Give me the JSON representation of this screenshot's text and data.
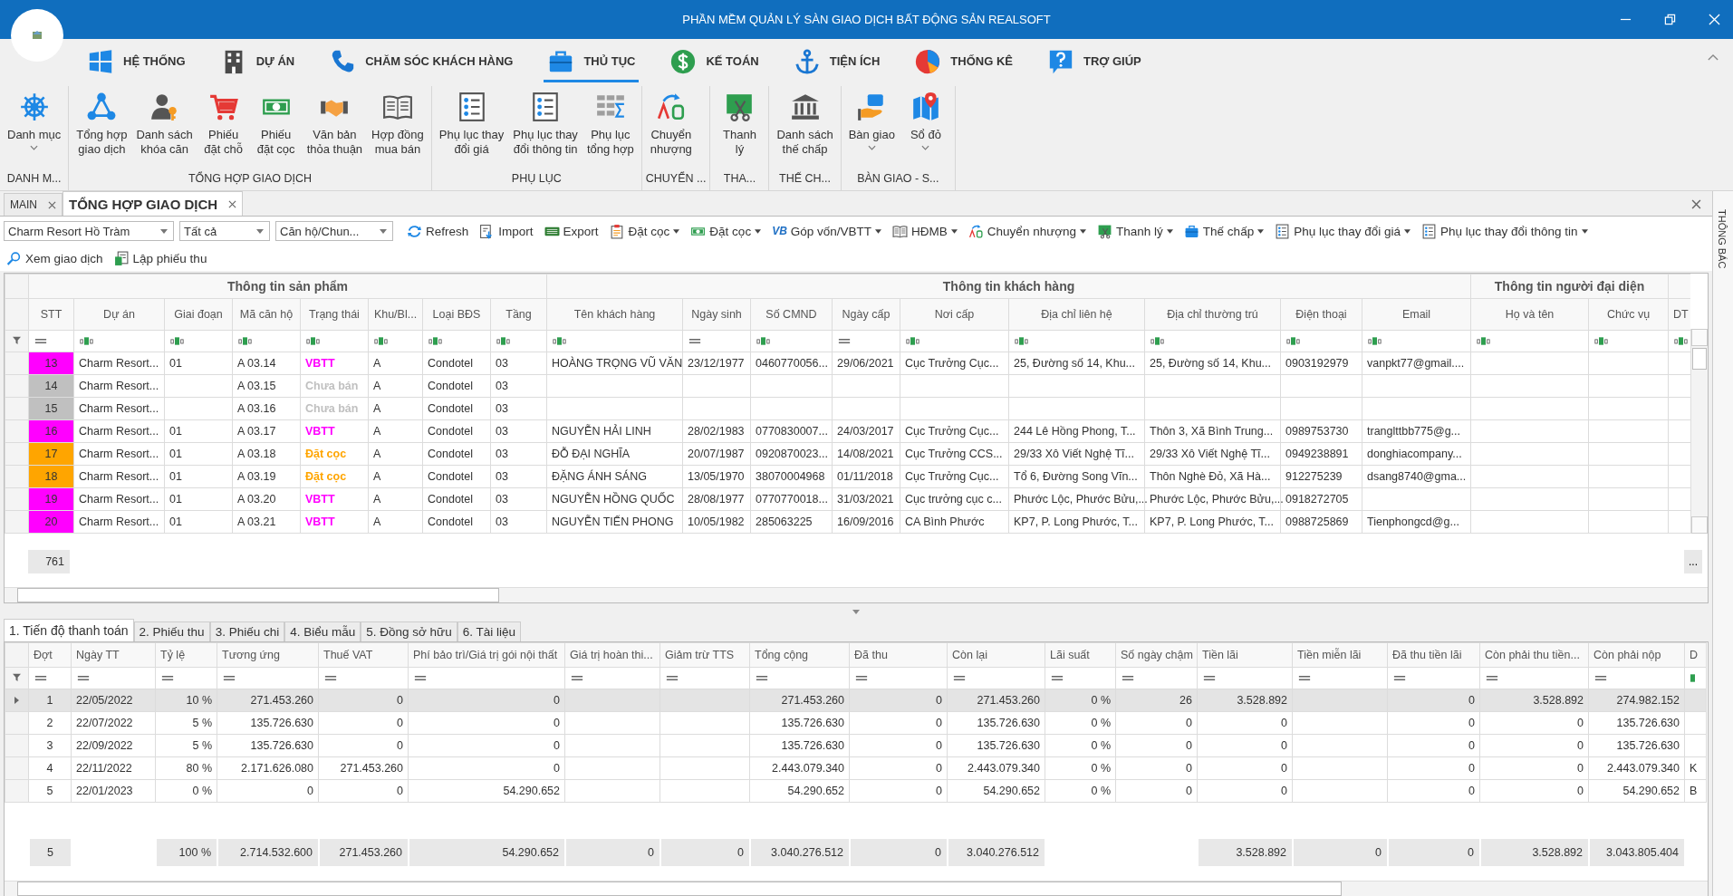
{
  "window": {
    "title": "PHẦN MỀM QUẢN LÝ SÀN GIAO DỊCH BẤT ĐỘNG SẢN REALSOFT"
  },
  "ribbon_tabs": [
    {
      "label": "HỆ THỐNG",
      "selected": false
    },
    {
      "label": "DỰ ÁN",
      "selected": false
    },
    {
      "label": "CHĂM SÓC KHÁCH HÀNG",
      "selected": false
    },
    {
      "label": "THỦ TỤC",
      "selected": true
    },
    {
      "label": "KẾ TOÁN",
      "selected": false
    },
    {
      "label": "TIỆN ÍCH",
      "selected": false
    },
    {
      "label": "THỐNG KÊ",
      "selected": false
    },
    {
      "label": "TRỢ GIÚP",
      "selected": false
    }
  ],
  "ribbon_groups": [
    {
      "label": "DANH M...",
      "buttons": [
        {
          "label": "Danh mục",
          "dropdown": true
        }
      ]
    },
    {
      "label": "TỔNG HỢP GIAO DỊCH",
      "buttons": [
        {
          "label": "Tổng hợp\ngiao dịch",
          "dropdown": false
        },
        {
          "label": "Danh sách\nkhóa căn",
          "dropdown": false
        },
        {
          "label": "Phiếu\nđặt chỗ",
          "dropdown": false
        },
        {
          "label": "Phiếu\nđặt cọc",
          "dropdown": false
        },
        {
          "label": "Văn bản\nthỏa thuận",
          "dropdown": false
        },
        {
          "label": "Hợp đồng\nmua bán",
          "dropdown": false
        }
      ]
    },
    {
      "label": "PHỤ LỤC",
      "buttons": [
        {
          "label": "Phụ lục thay\nđổi giá",
          "dropdown": false
        },
        {
          "label": "Phụ lục thay\nđổi thông tin",
          "dropdown": false
        },
        {
          "label": "Phụ lục\ntổng hợp",
          "dropdown": false
        }
      ]
    },
    {
      "label": "CHUYỂN ...",
      "buttons": [
        {
          "label": "Chuyển\nnhượng",
          "dropdown": false
        }
      ]
    },
    {
      "label": "THA...",
      "buttons": [
        {
          "label": "Thanh\nlý",
          "dropdown": false
        }
      ]
    },
    {
      "label": "THẾ CH...",
      "buttons": [
        {
          "label": "Danh sách\nthế chấp",
          "dropdown": false
        }
      ]
    },
    {
      "label": "BÀN GIAO - S...",
      "buttons": [
        {
          "label": "Bàn giao",
          "dropdown": true
        },
        {
          "label": "Sổ đỏ",
          "dropdown": true
        }
      ]
    }
  ],
  "doc_tabs": [
    {
      "label": "MAIN",
      "selected": false
    },
    {
      "label": "TỔNG HỢP GIAO DỊCH",
      "selected": true
    }
  ],
  "side_panel": {
    "title": "THÔNG BÁC"
  },
  "toolbar": {
    "combos": [
      "Charm Resort Hồ Tràm",
      "Tất cả",
      "Căn hộ/Chun..."
    ],
    "buttons": [
      {
        "label": "Refresh",
        "dropdown": false
      },
      {
        "label": "Import",
        "dropdown": false
      },
      {
        "label": "Export",
        "dropdown": false
      },
      {
        "label": "Đặt cọc",
        "dropdown": true
      },
      {
        "label": "Đặt cọc",
        "dropdown": true
      },
      {
        "label": "Góp vốn/VBTT",
        "dropdown": true,
        "badge": "VB"
      },
      {
        "label": "HĐMB",
        "dropdown": true
      },
      {
        "label": "Chuyển nhượng",
        "dropdown": true
      },
      {
        "label": "Thanh lý",
        "dropdown": true
      },
      {
        "label": "Thế chấp",
        "dropdown": true
      },
      {
        "label": "Phụ lục thay đổi giá",
        "dropdown": true
      },
      {
        "label": "Phụ lục thay đổi thông tin",
        "dropdown": true
      }
    ],
    "buttons_2": [
      {
        "label": "Xem giao dịch"
      },
      {
        "label": "Lập phiếu thu"
      }
    ]
  },
  "upper": {
    "bands": [
      {
        "label": "Thông tin sản phẩm",
        "columns": [
          {
            "label": "STT",
            "text_filter": false,
            "kind": "stt"
          },
          {
            "label": "Dự án",
            "text_filter": true,
            "kind": "text"
          },
          {
            "label": "Giai đoạn",
            "text_filter": true,
            "kind": "text"
          },
          {
            "label": "Mã căn hộ",
            "text_filter": true,
            "kind": "text"
          },
          {
            "label": "Trạng thái",
            "text_filter": true,
            "kind": "status"
          },
          {
            "label": "Khu/Bl...",
            "text_filter": true,
            "kind": "text"
          },
          {
            "label": "Loại BĐS",
            "text_filter": true,
            "kind": "text"
          },
          {
            "label": "Tầng",
            "text_filter": true,
            "kind": "text"
          }
        ]
      },
      {
        "label": "Thông tin khách hàng",
        "columns": [
          {
            "label": "Tên khách hàng",
            "text_filter": true,
            "kind": "text"
          },
          {
            "label": "Ngày sinh",
            "text_filter": false,
            "kind": "text"
          },
          {
            "label": "Số CMND",
            "text_filter": true,
            "kind": "text"
          },
          {
            "label": "Ngày cấp",
            "text_filter": false,
            "kind": "text"
          },
          {
            "label": "Nơi cấp",
            "text_filter": true,
            "kind": "text"
          },
          {
            "label": "Địa chỉ liên hệ",
            "text_filter": true,
            "kind": "text"
          },
          {
            "label": "Địa chỉ thường trú",
            "text_filter": true,
            "kind": "text"
          },
          {
            "label": "Điện thoại",
            "text_filter": true,
            "kind": "text"
          },
          {
            "label": "Email",
            "text_filter": true,
            "kind": "text"
          }
        ]
      },
      {
        "label": "Thông tin người đại diện",
        "columns": [
          {
            "label": "Họ và tên",
            "text_filter": true,
            "kind": "text"
          },
          {
            "label": "Chức vụ",
            "text_filter": true,
            "kind": "text"
          }
        ]
      },
      {
        "columns": [
          {
            "label": "DT",
            "text_filter": true,
            "kind": "text"
          }
        ]
      }
    ],
    "rows": [
      {
        "color": "#ff00ff",
        "cells": [
          "13",
          "Charm Resort...",
          "01",
          "A 03.14",
          "VBTT",
          "A",
          "Condotel",
          "03",
          "HOÀNG TRỌNG VŨ VĂN",
          "23/12/1977",
          "0460770056...",
          "29/06/2021",
          "Cục Trưởng Cục...",
          "25, Đường số 14, Khu...",
          "25, Đường số 14, Khu...",
          "0903192979",
          "vanpkt77@gmail....",
          null,
          null,
          null
        ]
      },
      {
        "color": "#c0c0c0",
        "cells": [
          "14",
          "Charm Resort...",
          null,
          "A 03.15",
          "Chưa bán",
          "A",
          "Condotel",
          "03",
          null,
          null,
          null,
          null,
          null,
          null,
          null,
          null,
          null,
          null,
          null,
          null
        ]
      },
      {
        "color": "#c0c0c0",
        "cells": [
          "15",
          "Charm Resort...",
          null,
          "A 03.16",
          "Chưa bán",
          "A",
          "Condotel",
          "03",
          null,
          null,
          null,
          null,
          null,
          null,
          null,
          null,
          null,
          null,
          null,
          null
        ]
      },
      {
        "color": "#ff00ff",
        "cells": [
          "16",
          "Charm Resort...",
          "01",
          "A 03.17",
          "VBTT",
          "A",
          "Condotel",
          "03",
          "NGUYỄN HẢI LINH",
          "28/02/1983",
          "0770830007...",
          "24/03/2017",
          "Cục Trưởng Cục...",
          "244 Lê Hồng Phong, T...",
          "Thôn 3, Xã Bình Trung...",
          "0989753730",
          "tranglttbb775@g...",
          null,
          null,
          null
        ]
      },
      {
        "color": "#ffa500",
        "cells": [
          "17",
          "Charm Resort...",
          "01",
          "A 03.18",
          "Đặt cọc",
          "A",
          "Condotel",
          "03",
          "ĐỖ ĐẠI NGHĨA",
          "20/07/1987",
          "0920870023...",
          "14/08/2021",
          "Cục Trưởng CCS...",
          "29/33 Xô Viết Nghệ Tĩ...",
          "29/33 Xô Viết Nghệ Tĩ...",
          "0949238891",
          "donghiacompany...",
          null,
          null,
          null
        ]
      },
      {
        "color": "#ffa500",
        "cells": [
          "18",
          "Charm Resort...",
          "01",
          "A 03.19",
          "Đặt cọc",
          "A",
          "Condotel",
          "03",
          "ĐẶNG ÁNH SÁNG",
          "13/05/1970",
          "38070004968",
          "01/11/2018",
          "Cục Trưởng Cục...",
          "Tổ 6, Đường Song Vĩn...",
          "Thôn Nghè Đỏ, Xã Hà...",
          "912275239",
          "dsang8740@gma...",
          null,
          null,
          null
        ]
      },
      {
        "color": "#ff00ff",
        "cells": [
          "19",
          "Charm Resort...",
          "01",
          "A 03.20",
          "VBTT",
          "A",
          "Condotel",
          "03",
          "NGUYỄN HỒNG QUỐC",
          "28/08/1977",
          "0770770018...",
          "31/03/2021",
          "Cục trưởng cục c...",
          "Phước Lộc, Phước Bửu,...",
          "Phước Lộc, Phước Bửu,...",
          "0918272705",
          null,
          null,
          null,
          null
        ]
      },
      {
        "color": "#ff00ff",
        "cells": [
          "20",
          "Charm Resort...",
          "01",
          "A 03.21",
          "VBTT",
          "A",
          "Condotel",
          "03",
          "NGUYỄN TIẾN PHONG",
          "10/05/1982",
          "285063225",
          "16/09/2016",
          "CA Bình Phước",
          "KP7, P. Long Phước, T...",
          "KP7, P. Long Phước, T...",
          "0988725869",
          "Tienphongcd@g...",
          null,
          null,
          null
        ]
      }
    ],
    "total": "761",
    "more_button": "..."
  },
  "lower_tabs": [
    {
      "label": "1. Tiến độ thanh toán",
      "selected": true
    },
    {
      "label": "2. Phiếu thu",
      "selected": false
    },
    {
      "label": "3. Phiếu chi",
      "selected": false
    },
    {
      "label": "4. Biểu mẫu",
      "selected": false
    },
    {
      "label": "5. Đồng sở hữu",
      "selected": false
    },
    {
      "label": "6. Tài liệu",
      "selected": false
    }
  ],
  "lower": {
    "columns": [
      {
        "label": "Đợt",
        "kind": "center",
        "text_filter": false
      },
      {
        "label": "Ngày TT",
        "kind": "text",
        "text_filter": false
      },
      {
        "label": "Tỷ lệ",
        "kind": "number",
        "text_filter": false
      },
      {
        "label": "Tương ứng",
        "kind": "number",
        "text_filter": false
      },
      {
        "label": "Thuế VAT",
        "kind": "number",
        "text_filter": false
      },
      {
        "label": "Phí bảo trì/Giá trị gói nội thất",
        "kind": "number",
        "text_filter": false
      },
      {
        "label": "Giá trị hoàn thi...",
        "kind": "number",
        "text_filter": false
      },
      {
        "label": "Giảm trừ TTS",
        "kind": "number",
        "text_filter": false
      },
      {
        "label": "Tổng cộng",
        "kind": "number",
        "text_filter": false
      },
      {
        "label": "Đã thu",
        "kind": "number",
        "text_filter": false
      },
      {
        "label": "Còn lại",
        "kind": "number",
        "text_filter": false
      },
      {
        "label": "Lãi suất",
        "kind": "number",
        "text_filter": false
      },
      {
        "label": "Số ngày chậm",
        "kind": "number",
        "text_filter": false
      },
      {
        "label": "Tiền lãi",
        "kind": "number",
        "text_filter": false
      },
      {
        "label": "Tiền miễn lãi",
        "kind": "number",
        "text_filter": false
      },
      {
        "label": "Đã thu tiền lãi",
        "kind": "number",
        "text_filter": false
      },
      {
        "label": "Còn phải thu tiền...",
        "kind": "number",
        "text_filter": false
      },
      {
        "label": "Còn phải nộp",
        "kind": "number",
        "text_filter": false
      },
      {
        "label": "D",
        "kind": "text",
        "text_filter": true
      }
    ],
    "rows": [
      {
        "selected": true,
        "cells": [
          "1",
          "22/05/2022",
          "10 %",
          "271.453.260",
          "0",
          "0",
          null,
          null,
          "271.453.260",
          "0",
          "271.453.260",
          "0 %",
          "26",
          "3.528.892",
          null,
          "0",
          "3.528.892",
          "274.982.152",
          null
        ]
      },
      {
        "selected": false,
        "cells": [
          "2",
          "22/07/2022",
          "5 %",
          "135.726.630",
          "0",
          "0",
          null,
          null,
          "135.726.630",
          "0",
          "135.726.630",
          "0 %",
          "0",
          "0",
          null,
          "0",
          "0",
          "135.726.630",
          null
        ]
      },
      {
        "selected": false,
        "cells": [
          "3",
          "22/09/2022",
          "5 %",
          "135.726.630",
          "0",
          "0",
          null,
          null,
          "135.726.630",
          "0",
          "135.726.630",
          "0 %",
          "0",
          "0",
          null,
          "0",
          "0",
          "135.726.630",
          null
        ]
      },
      {
        "selected": false,
        "cells": [
          "4",
          "22/11/2022",
          "80 %",
          "2.171.626.080",
          "271.453.260",
          "0",
          null,
          null,
          "2.443.079.340",
          "0",
          "2.443.079.340",
          "0 %",
          "0",
          "0",
          null,
          "0",
          "0",
          "2.443.079.340",
          "K"
        ]
      },
      {
        "selected": false,
        "cells": [
          "5",
          "22/01/2023",
          "0 %",
          "0",
          "0",
          "54.290.652",
          null,
          null,
          "54.290.652",
          "0",
          "54.290.652",
          "0 %",
          "0",
          "0",
          null,
          "0",
          "0",
          "54.290.652",
          "B"
        ]
      }
    ],
    "footer": {
      "cells": [
        "5",
        null,
        "100 %",
        "2.714.532.600",
        "271.453.260",
        "54.290.652",
        "0",
        "0",
        "3.040.276.512",
        "0",
        "3.040.276.512",
        null,
        null,
        "3.528.892",
        "0",
        "0",
        "3.528.892",
        "3.043.805.404",
        null
      ]
    }
  }
}
